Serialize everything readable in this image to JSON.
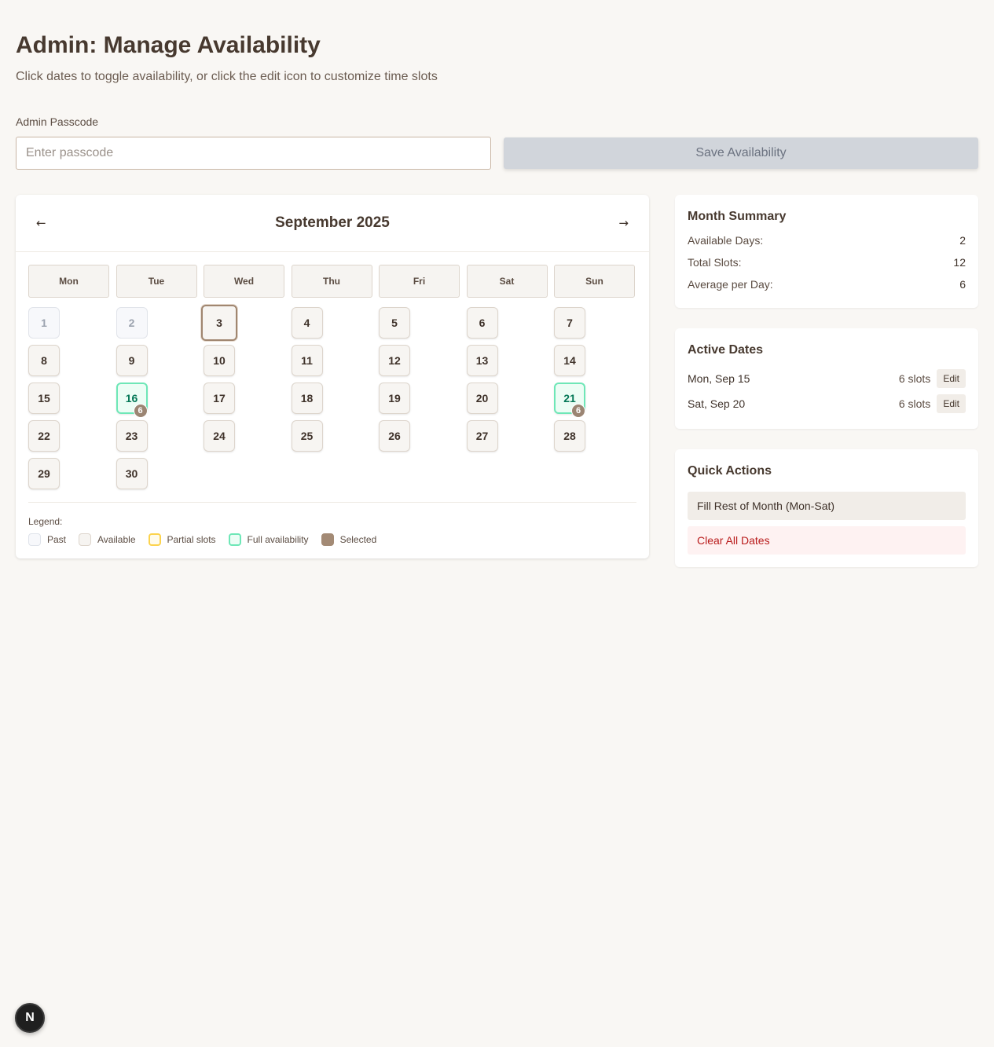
{
  "header": {
    "title": "Admin: Manage Availability",
    "subtitle": "Click dates to toggle availability, or click the edit icon to customize time slots"
  },
  "passcode": {
    "label": "Admin Passcode",
    "placeholder": "Enter passcode",
    "value": ""
  },
  "save_button": "Save Availability",
  "calendar": {
    "prev_arrow": "←",
    "next_arrow": "→",
    "month_title": "September 2025",
    "weekdays": [
      "Mon",
      "Tue",
      "Wed",
      "Thu",
      "Fri",
      "Sat",
      "Sun"
    ],
    "days": [
      {
        "label": "1",
        "state": "past"
      },
      {
        "label": "2",
        "state": "past"
      },
      {
        "label": "3",
        "state": "today"
      },
      {
        "label": "4",
        "state": "available"
      },
      {
        "label": "5",
        "state": "available"
      },
      {
        "label": "6",
        "state": "available"
      },
      {
        "label": "7",
        "state": "available"
      },
      {
        "label": "8",
        "state": "available"
      },
      {
        "label": "9",
        "state": "available"
      },
      {
        "label": "10",
        "state": "available"
      },
      {
        "label": "11",
        "state": "available"
      },
      {
        "label": "12",
        "state": "available"
      },
      {
        "label": "13",
        "state": "available"
      },
      {
        "label": "14",
        "state": "available"
      },
      {
        "label": "15",
        "state": "available"
      },
      {
        "label": "16",
        "state": "full",
        "badge": "6"
      },
      {
        "label": "17",
        "state": "available"
      },
      {
        "label": "18",
        "state": "available"
      },
      {
        "label": "19",
        "state": "available"
      },
      {
        "label": "20",
        "state": "available"
      },
      {
        "label": "21",
        "state": "full",
        "badge": "6"
      },
      {
        "label": "22",
        "state": "available"
      },
      {
        "label": "23",
        "state": "available"
      },
      {
        "label": "24",
        "state": "available"
      },
      {
        "label": "25",
        "state": "available"
      },
      {
        "label": "26",
        "state": "available"
      },
      {
        "label": "27",
        "state": "available"
      },
      {
        "label": "28",
        "state": "available"
      },
      {
        "label": "29",
        "state": "available"
      },
      {
        "label": "30",
        "state": "available"
      }
    ],
    "legend_title": "Legend:",
    "legend": [
      {
        "label": "Past",
        "key": "past"
      },
      {
        "label": "Available",
        "key": "avail"
      },
      {
        "label": "Partial slots",
        "key": "partial"
      },
      {
        "label": "Full availability",
        "key": "fullav"
      },
      {
        "label": "Selected",
        "key": "sel"
      }
    ]
  },
  "month_summary": {
    "title": "Month Summary",
    "rows": [
      {
        "label": "Available Days:",
        "value": "2"
      },
      {
        "label": "Total Slots:",
        "value": "12"
      },
      {
        "label": "Average per Day:",
        "value": "6"
      }
    ]
  },
  "active_dates": {
    "title": "Active Dates",
    "rows": [
      {
        "date": "Mon, Sep 15",
        "slots": "6 slots",
        "edit": "Edit"
      },
      {
        "date": "Sat, Sep 20",
        "slots": "6 slots",
        "edit": "Edit"
      }
    ]
  },
  "quick_actions": {
    "title": "Quick Actions",
    "fill_label": "Fill Rest of Month (Mon-Sat)",
    "clear_label": "Clear All Dates"
  },
  "floating_badge": "N",
  "colors": {
    "background": "#f9f7f4",
    "accent": "#a38a75",
    "full_border": "#6ee7b7",
    "full_text": "#047857",
    "danger": "#b91c1c"
  }
}
